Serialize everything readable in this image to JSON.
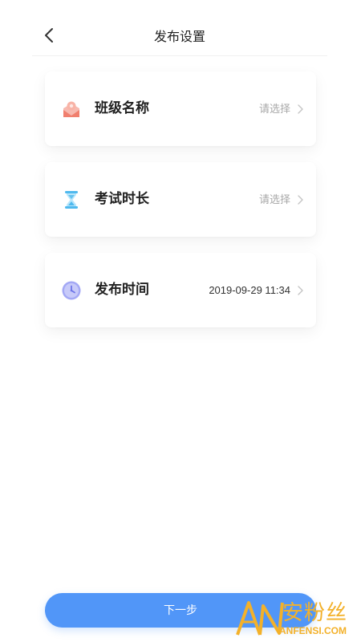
{
  "header": {
    "title": "发布设置",
    "back_icon": "chevron-left-icon"
  },
  "settings": [
    {
      "label": "班级名称",
      "value": "请选择",
      "value_is_placeholder": true,
      "icon": "class-icon",
      "icon_color": "#f07f6e"
    },
    {
      "label": "考试时长",
      "value": "请选择",
      "value_is_placeholder": true,
      "icon": "hourglass-icon",
      "icon_color": "#4fb9ee"
    },
    {
      "label": "发布时间",
      "value": "2019-09-29 11:34",
      "value_is_placeholder": false,
      "icon": "clock-icon",
      "icon_color": "#8a90f2"
    }
  ],
  "next_button": {
    "label": "下一步",
    "color": "#5196f8"
  },
  "watermark": {
    "logo_text": "AN",
    "cn_text": "安粉丝",
    "en_text": "ANFENSI.COM",
    "color": "#f3b12a"
  }
}
